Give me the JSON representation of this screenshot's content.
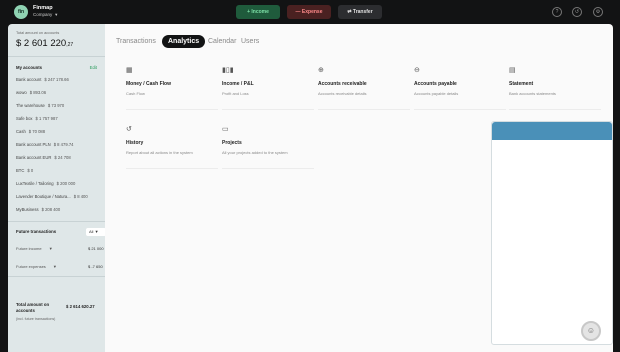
{
  "app": {
    "name": "Finmap",
    "company": "Company",
    "logo_text": "fin"
  },
  "topbar": {
    "income_label": "+ Income",
    "expense_label": "— Expense",
    "transfer_label": "⇄ Transfer",
    "icons": [
      "help-icon",
      "history-icon",
      "settings-icon"
    ]
  },
  "sidebar": {
    "total_label": "Total amount on accounts",
    "total_value": "$ 2 601 220",
    "total_cents": ",27",
    "my_accounts_label": "My accounts",
    "edit_label": "Edit",
    "accounts": [
      {
        "name": "Bank account",
        "amount": "$ 247 178.66"
      },
      {
        "name": "wowo",
        "amount": "$ 893.06"
      },
      {
        "name": "The warehouse",
        "amount": "$ 73 970"
      },
      {
        "name": "Safe box",
        "amount": "$ 1 757 987"
      },
      {
        "name": "Cash",
        "amount": "$ 70 088"
      },
      {
        "name": "Bank account PLN",
        "amount": "$ 8 479.74"
      },
      {
        "name": "Bank account EUR",
        "amount": "$ 24 708"
      },
      {
        "name": "BTC",
        "amount": "$ 0"
      },
      {
        "name": "LuxTextile / Tailoring",
        "amount": "$ 200 000"
      },
      {
        "name": "Lavender Boutique / Natura...",
        "amount": "$ 8 400"
      },
      {
        "name": "MyBusiness",
        "amount": "$ 208 400"
      }
    ],
    "future_label": "Future transactions",
    "future_filter": "All",
    "future_income_label": "Future income",
    "future_income_value": "$ 21 000",
    "future_expenses_label": "Future expenses",
    "future_expenses_value": "$ -7 650",
    "total_incl_label": "Total amount on accounts",
    "total_incl_value": "$ 2 614 620.27",
    "total_incl_note": "(incl. future transactions)"
  },
  "tabs": [
    "Transactions",
    "Analytics",
    "Calendar",
    "Users"
  ],
  "active_tab": "Analytics",
  "cards": [
    {
      "icon": "calendar-icon",
      "title": "Money / Cash Flow",
      "desc": "Cash Flow"
    },
    {
      "icon": "bar-chart-icon",
      "title": "Income / P&L",
      "desc": "Profit and Loss"
    },
    {
      "icon": "arrow-in-icon",
      "title": "Accounts receivable",
      "desc": "Accounts receivable details"
    },
    {
      "icon": "arrow-out-icon",
      "title": "Accounts payable",
      "desc": "Accounts payable details"
    },
    {
      "icon": "document-icon",
      "title": "Statement",
      "desc": "Bank accounts statements"
    },
    {
      "icon": "history-icon",
      "title": "History",
      "desc": "Report about all actions in the system"
    },
    {
      "icon": "folder-icon",
      "title": "Projects",
      "desc": "All your projects added to the system"
    }
  ]
}
